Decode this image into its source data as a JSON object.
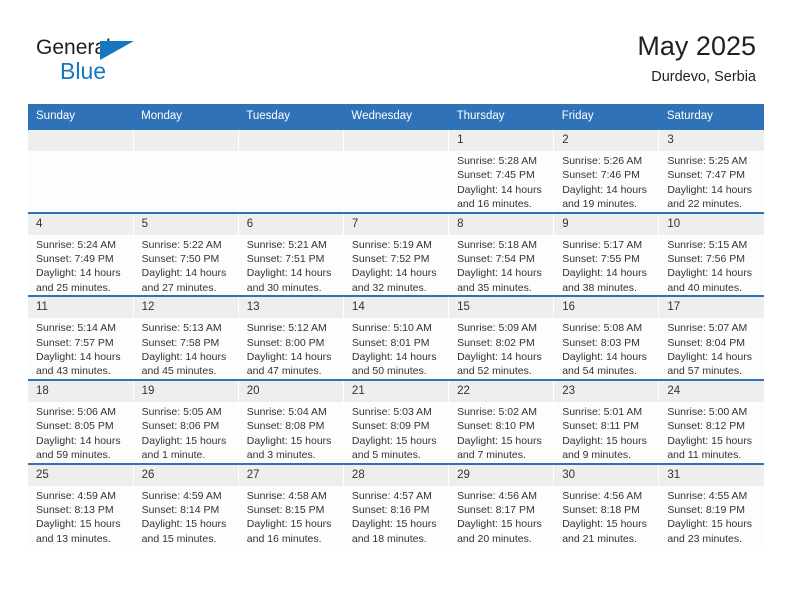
{
  "brand": {
    "name_part1": "General",
    "name_part2": "Blue",
    "triangle_icon": "triangle-icon",
    "colors": {
      "dark": "#231f20",
      "blue": "#1477c0"
    }
  },
  "header": {
    "title": "May 2025",
    "location": "Durdevo, Serbia"
  },
  "theme": {
    "header_blue": "#3072b8",
    "daynum_band": "#eeeeee",
    "cell_bg": "#fdfdfd"
  },
  "weekdays": [
    "Sunday",
    "Monday",
    "Tuesday",
    "Wednesday",
    "Thursday",
    "Friday",
    "Saturday"
  ],
  "labels": {
    "sunrise_prefix": "Sunrise:",
    "sunset_prefix": "Sunset:",
    "daylight_prefix": "Daylight:"
  },
  "weeks": [
    [
      {
        "day": "",
        "empty": true
      },
      {
        "day": "",
        "empty": true
      },
      {
        "day": "",
        "empty": true
      },
      {
        "day": "",
        "empty": true
      },
      {
        "day": "1",
        "sunrise": "Sunrise: 5:28 AM",
        "sunset": "Sunset: 7:45 PM",
        "daylight_line1": "Daylight: 14 hours",
        "daylight_line2": "and 16 minutes."
      },
      {
        "day": "2",
        "sunrise": "Sunrise: 5:26 AM",
        "sunset": "Sunset: 7:46 PM",
        "daylight_line1": "Daylight: 14 hours",
        "daylight_line2": "and 19 minutes."
      },
      {
        "day": "3",
        "sunrise": "Sunrise: 5:25 AM",
        "sunset": "Sunset: 7:47 PM",
        "daylight_line1": "Daylight: 14 hours",
        "daylight_line2": "and 22 minutes."
      }
    ],
    [
      {
        "day": "4",
        "sunrise": "Sunrise: 5:24 AM",
        "sunset": "Sunset: 7:49 PM",
        "daylight_line1": "Daylight: 14 hours",
        "daylight_line2": "and 25 minutes."
      },
      {
        "day": "5",
        "sunrise": "Sunrise: 5:22 AM",
        "sunset": "Sunset: 7:50 PM",
        "daylight_line1": "Daylight: 14 hours",
        "daylight_line2": "and 27 minutes."
      },
      {
        "day": "6",
        "sunrise": "Sunrise: 5:21 AM",
        "sunset": "Sunset: 7:51 PM",
        "daylight_line1": "Daylight: 14 hours",
        "daylight_line2": "and 30 minutes."
      },
      {
        "day": "7",
        "sunrise": "Sunrise: 5:19 AM",
        "sunset": "Sunset: 7:52 PM",
        "daylight_line1": "Daylight: 14 hours",
        "daylight_line2": "and 32 minutes."
      },
      {
        "day": "8",
        "sunrise": "Sunrise: 5:18 AM",
        "sunset": "Sunset: 7:54 PM",
        "daylight_line1": "Daylight: 14 hours",
        "daylight_line2": "and 35 minutes."
      },
      {
        "day": "9",
        "sunrise": "Sunrise: 5:17 AM",
        "sunset": "Sunset: 7:55 PM",
        "daylight_line1": "Daylight: 14 hours",
        "daylight_line2": "and 38 minutes."
      },
      {
        "day": "10",
        "sunrise": "Sunrise: 5:15 AM",
        "sunset": "Sunset: 7:56 PM",
        "daylight_line1": "Daylight: 14 hours",
        "daylight_line2": "and 40 minutes."
      }
    ],
    [
      {
        "day": "11",
        "sunrise": "Sunrise: 5:14 AM",
        "sunset": "Sunset: 7:57 PM",
        "daylight_line1": "Daylight: 14 hours",
        "daylight_line2": "and 43 minutes."
      },
      {
        "day": "12",
        "sunrise": "Sunrise: 5:13 AM",
        "sunset": "Sunset: 7:58 PM",
        "daylight_line1": "Daylight: 14 hours",
        "daylight_line2": "and 45 minutes."
      },
      {
        "day": "13",
        "sunrise": "Sunrise: 5:12 AM",
        "sunset": "Sunset: 8:00 PM",
        "daylight_line1": "Daylight: 14 hours",
        "daylight_line2": "and 47 minutes."
      },
      {
        "day": "14",
        "sunrise": "Sunrise: 5:10 AM",
        "sunset": "Sunset: 8:01 PM",
        "daylight_line1": "Daylight: 14 hours",
        "daylight_line2": "and 50 minutes."
      },
      {
        "day": "15",
        "sunrise": "Sunrise: 5:09 AM",
        "sunset": "Sunset: 8:02 PM",
        "daylight_line1": "Daylight: 14 hours",
        "daylight_line2": "and 52 minutes."
      },
      {
        "day": "16",
        "sunrise": "Sunrise: 5:08 AM",
        "sunset": "Sunset: 8:03 PM",
        "daylight_line1": "Daylight: 14 hours",
        "daylight_line2": "and 54 minutes."
      },
      {
        "day": "17",
        "sunrise": "Sunrise: 5:07 AM",
        "sunset": "Sunset: 8:04 PM",
        "daylight_line1": "Daylight: 14 hours",
        "daylight_line2": "and 57 minutes."
      }
    ],
    [
      {
        "day": "18",
        "sunrise": "Sunrise: 5:06 AM",
        "sunset": "Sunset: 8:05 PM",
        "daylight_line1": "Daylight: 14 hours",
        "daylight_line2": "and 59 minutes."
      },
      {
        "day": "19",
        "sunrise": "Sunrise: 5:05 AM",
        "sunset": "Sunset: 8:06 PM",
        "daylight_line1": "Daylight: 15 hours",
        "daylight_line2": "and 1 minute."
      },
      {
        "day": "20",
        "sunrise": "Sunrise: 5:04 AM",
        "sunset": "Sunset: 8:08 PM",
        "daylight_line1": "Daylight: 15 hours",
        "daylight_line2": "and 3 minutes."
      },
      {
        "day": "21",
        "sunrise": "Sunrise: 5:03 AM",
        "sunset": "Sunset: 8:09 PM",
        "daylight_line1": "Daylight: 15 hours",
        "daylight_line2": "and 5 minutes."
      },
      {
        "day": "22",
        "sunrise": "Sunrise: 5:02 AM",
        "sunset": "Sunset: 8:10 PM",
        "daylight_line1": "Daylight: 15 hours",
        "daylight_line2": "and 7 minutes."
      },
      {
        "day": "23",
        "sunrise": "Sunrise: 5:01 AM",
        "sunset": "Sunset: 8:11 PM",
        "daylight_line1": "Daylight: 15 hours",
        "daylight_line2": "and 9 minutes."
      },
      {
        "day": "24",
        "sunrise": "Sunrise: 5:00 AM",
        "sunset": "Sunset: 8:12 PM",
        "daylight_line1": "Daylight: 15 hours",
        "daylight_line2": "and 11 minutes."
      }
    ],
    [
      {
        "day": "25",
        "sunrise": "Sunrise: 4:59 AM",
        "sunset": "Sunset: 8:13 PM",
        "daylight_line1": "Daylight: 15 hours",
        "daylight_line2": "and 13 minutes."
      },
      {
        "day": "26",
        "sunrise": "Sunrise: 4:59 AM",
        "sunset": "Sunset: 8:14 PM",
        "daylight_line1": "Daylight: 15 hours",
        "daylight_line2": "and 15 minutes."
      },
      {
        "day": "27",
        "sunrise": "Sunrise: 4:58 AM",
        "sunset": "Sunset: 8:15 PM",
        "daylight_line1": "Daylight: 15 hours",
        "daylight_line2": "and 16 minutes."
      },
      {
        "day": "28",
        "sunrise": "Sunrise: 4:57 AM",
        "sunset": "Sunset: 8:16 PM",
        "daylight_line1": "Daylight: 15 hours",
        "daylight_line2": "and 18 minutes."
      },
      {
        "day": "29",
        "sunrise": "Sunrise: 4:56 AM",
        "sunset": "Sunset: 8:17 PM",
        "daylight_line1": "Daylight: 15 hours",
        "daylight_line2": "and 20 minutes."
      },
      {
        "day": "30",
        "sunrise": "Sunrise: 4:56 AM",
        "sunset": "Sunset: 8:18 PM",
        "daylight_line1": "Daylight: 15 hours",
        "daylight_line2": "and 21 minutes."
      },
      {
        "day": "31",
        "sunrise": "Sunrise: 4:55 AM",
        "sunset": "Sunset: 8:19 PM",
        "daylight_line1": "Daylight: 15 hours",
        "daylight_line2": "and 23 minutes."
      }
    ]
  ]
}
